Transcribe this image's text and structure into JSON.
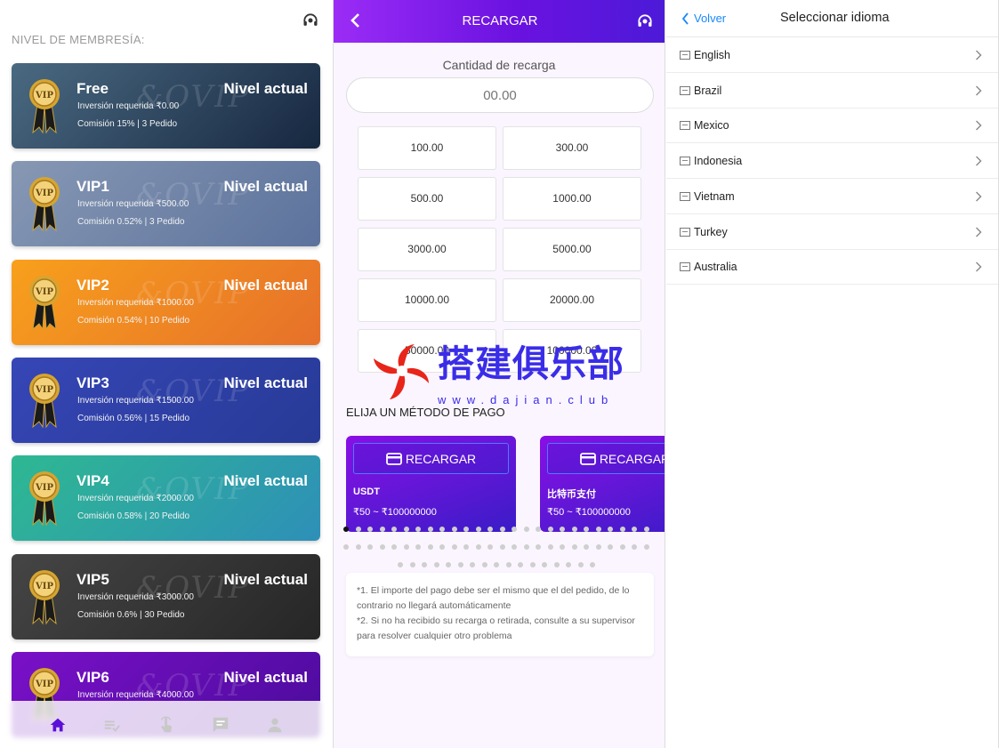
{
  "membership": {
    "section_title": "NIVEL DE MEMBRESÍA:",
    "levels": [
      {
        "name": "Free",
        "status": "Nivel actual",
        "investment": "Inversión requerida ₹0.00",
        "commission": "Comisión 15% | 3 Pedido",
        "color_from": "#4a6a82",
        "color_to": "#172740"
      },
      {
        "name": "VIP1",
        "status": "Nivel actual",
        "investment": "Inversión requerida ₹500.00",
        "commission": "Comisión 0.52% | 3 Pedido",
        "color_from": "#8798b4",
        "color_to": "#5c729c"
      },
      {
        "name": "VIP2",
        "status": "Nivel actual",
        "investment": "Inversión requerida ₹1000.00",
        "commission": "Comisión 0.54% | 10 Pedido",
        "color_from": "#f8a01c",
        "color_to": "#e6702a"
      },
      {
        "name": "VIP3",
        "status": "Nivel actual",
        "investment": "Inversión requerida ₹1500.00",
        "commission": "Comisión 0.56% | 15 Pedido",
        "color_from": "#3646b6",
        "color_to": "#273a96"
      },
      {
        "name": "VIP4",
        "status": "Nivel actual",
        "investment": "Inversión requerida ₹2000.00",
        "commission": "Comisión 0.58% | 20 Pedido",
        "color_from": "#2eb892",
        "color_to": "#2e8fb8"
      },
      {
        "name": "VIP5",
        "status": "Nivel actual",
        "investment": "Inversión requerida ₹3000.00",
        "commission": "Comisión 0.6% | 30 Pedido",
        "color_from": "#454545",
        "color_to": "#262626"
      },
      {
        "name": "VIP6",
        "status": "Nivel actual",
        "investment": "Inversión requerida ₹4000.00",
        "commission": "",
        "color_from": "#7a10c8",
        "color_to": "#4b0b9c"
      }
    ],
    "watermark": "&OVIP",
    "tabbar": [
      "home-icon",
      "tasks-icon",
      "hand-tap-icon",
      "chat-icon",
      "profile-icon"
    ],
    "accent": "#5b10d8"
  },
  "recharge": {
    "title": "RECARGAR",
    "amount_label": "Cantidad de recarga",
    "amount_value": "00.00",
    "amounts": [
      "100.00",
      "300.00",
      "500.00",
      "1000.00",
      "3000.00",
      "5000.00",
      "10000.00",
      "20000.00",
      "50000.00",
      "100000.00"
    ],
    "methods_title": "ELIJA UN MÉTODO DE PAGO",
    "methods": [
      {
        "button": "RECARGAR",
        "name": "USDT",
        "range": "₹50 ~ ₹100000000"
      },
      {
        "button": "RECARGAR",
        "name": "比特币支付",
        "range": "₹50 ~ ₹100000000"
      }
    ],
    "notes": [
      "*1. El importe del pago debe ser el mismo que el del pedido, de lo contrario no llegará automáticamente",
      "*2. Si no ha recibido su recarga o retirada, consulte a su supervisor para resolver cualquier otro problema"
    ],
    "watermark_text": "搭建俱乐部",
    "watermark_url": "www.dajian.club"
  },
  "language": {
    "back_label": "Volver",
    "title": "Seleccionar idioma",
    "items": [
      "English",
      "Brazil",
      "Mexico",
      "Indonesia",
      "Vietnam",
      "Turkey",
      "Australia"
    ]
  }
}
